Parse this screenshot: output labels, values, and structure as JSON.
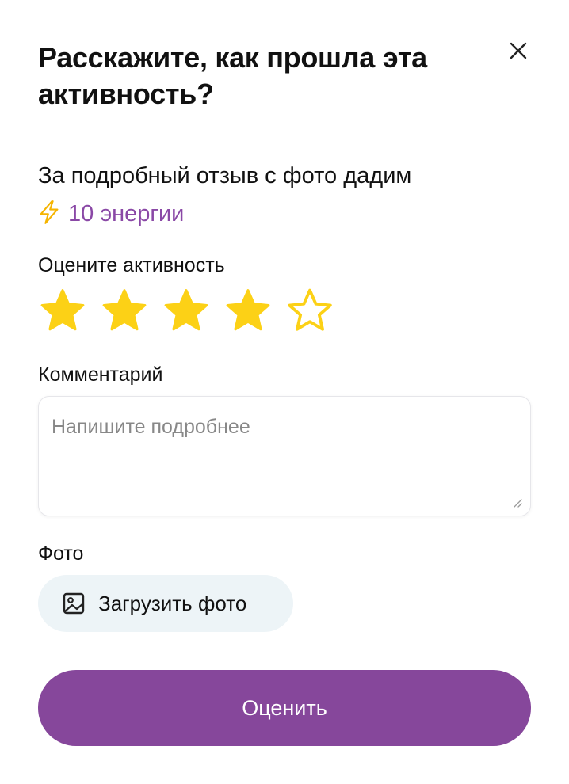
{
  "dialog": {
    "title": "Расскажите, как прошла эта активность?",
    "close_icon": "close-icon"
  },
  "intro": {
    "text": "За подробный отзыв с фото дадим",
    "reward_icon": "lightning-icon",
    "reward_text": "10 энергии"
  },
  "rating": {
    "label": "Оцените активность",
    "value": 4,
    "max": 5,
    "star_color": "#fcd116"
  },
  "comment": {
    "label": "Комментарий",
    "placeholder": "Напишите подробнее",
    "value": ""
  },
  "photo": {
    "label": "Фото",
    "upload_icon": "image-icon",
    "upload_label": "Загрузить фото"
  },
  "submit": {
    "label": "Оценить"
  },
  "colors": {
    "accent": "#86479b",
    "reward_text": "#8a48a6",
    "star": "#fcd116",
    "upload_bg": "#edf4f7"
  }
}
